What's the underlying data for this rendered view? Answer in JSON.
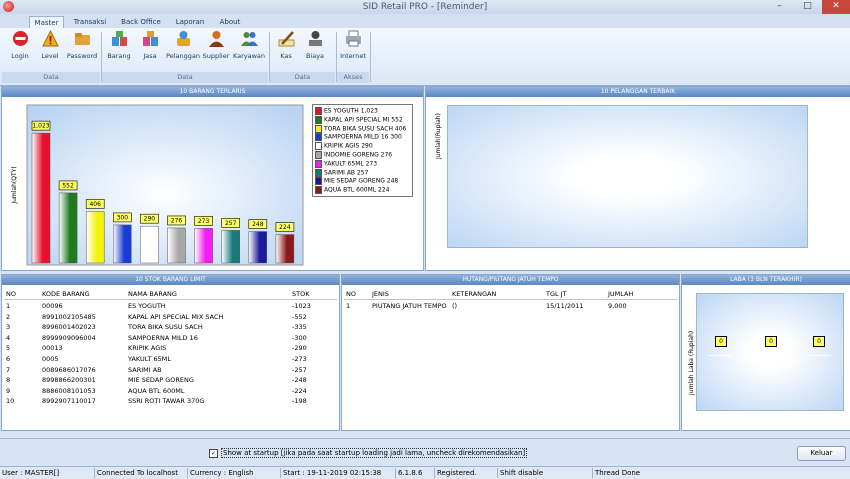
{
  "window": {
    "title": "SID Retail PRO - [Reminder]",
    "min": "–",
    "max": "□",
    "close": "✕"
  },
  "tabs": [
    "Master",
    "Transaksi",
    "Back Office",
    "Laporan",
    "About"
  ],
  "ribbon": {
    "buttons": [
      {
        "label": "Login",
        "color": "#d9252a",
        "icon": "no-entry-icon"
      },
      {
        "label": "Level",
        "color": "#e8b420",
        "icon": "warning-icon"
      },
      {
        "label": "Password",
        "color": "#e2a13a",
        "icon": "folder-icon"
      },
      {
        "label": "Barang",
        "color": "#3f8fd4",
        "icon": "boxes-icon"
      },
      {
        "label": "Jasa",
        "color": "#d04a8a",
        "icon": "boxes-icon"
      },
      {
        "label": "Pelanggan",
        "color": "#e5a32b",
        "icon": "customer-icon"
      },
      {
        "label": "Supplier",
        "color": "#d96a21",
        "icon": "person-icon"
      },
      {
        "label": "Karyawan",
        "color": "#4f8a3b",
        "icon": "people-icon"
      },
      {
        "label": "Kas",
        "color": "#b08438",
        "icon": "pen-icon"
      },
      {
        "label": "Biaya",
        "color": "#444444",
        "icon": "cost-icon"
      },
      {
        "label": "Internet",
        "color": "#6b7c8f",
        "icon": "printer-icon"
      }
    ],
    "groups": [
      "Data",
      "Data",
      "Data",
      "Akses"
    ]
  },
  "panels": {
    "top_items": "10 BARANG TERLARIS",
    "top_customers": "10 PELANGGAN TERBAIK",
    "stock": "10 STOK BARANG LIMIT",
    "debts": "HUTANG/PIUTANG JATUH TEMPO",
    "profit": "LABA (3 BLN TERAKHIR)"
  },
  "chart_data": [
    {
      "type": "bar",
      "title": "10 BARANG TERLARIS",
      "ylabel": "Jumlah(QTY)",
      "categories": [
        "ES YOGUTH",
        "KAPAL API SPECIAL MI",
        "TORA BIKA SUSU SACH",
        "SAMPOERNA MILD 16",
        "KRIPIK AGIS",
        "INDOMIE GORENG",
        "YAKULT 65ML",
        "SARIMI AB",
        "MIE SEDAP GORENG",
        "AQUA BTL 600ML"
      ],
      "values": [
        1023,
        552,
        406,
        300,
        290,
        276,
        273,
        257,
        248,
        224
      ],
      "value_labels": [
        "1,023",
        "552",
        "406",
        "300",
        "290",
        "276",
        "273",
        "257",
        "248",
        "224"
      ],
      "legend": [
        "ES YOGUTH 1,023",
        "KAPAL API SPECIAL MI 552",
        "TORA BIKA SUSU SACH 406",
        "SAMPOERNA MILD 16 300",
        "KRIPIK AGIS 290",
        "INDOMIE GORENG 276",
        "YAKULT 65ML 273",
        "SARIMI AB 257",
        "MIE SEDAP GORENG 248",
        "AQUA BTL 600ML 224"
      ],
      "colors": [
        "#e8102a",
        "#1f7a1f",
        "#f2f20a",
        "#1a3cd6",
        "#ffffff",
        "#a8a8a8",
        "#f21ef2",
        "#1a7a7a",
        "#1a1a9a",
        "#8a1a1a"
      ],
      "legend_position": "right"
    },
    {
      "type": "bar",
      "title": "10 PELANGGAN TERBAIK",
      "ylabel": "Jumlah(Rupiah)",
      "categories": [],
      "values": []
    },
    {
      "type": "bar",
      "title": "LABA (3 BLN TERAKHIR)",
      "ylabel": "Jumlah Laba (Rupiah)",
      "categories": [
        "",
        "",
        ""
      ],
      "values": [
        0,
        0,
        0
      ],
      "value_labels": [
        "0",
        "0",
        "0"
      ]
    }
  ],
  "stock_table": {
    "headers": [
      "NO",
      "KODE BARANG",
      "NAMA BARANG",
      "STOK"
    ],
    "rows": [
      [
        "1",
        "00096",
        "ES YOGUTH",
        "-1023"
      ],
      [
        "2",
        "8991002105485",
        "KAPAL API SPECIAL MIX SACH",
        "-552"
      ],
      [
        "3",
        "8996001402023",
        "TORA BIKA SUSU SACH",
        "-335"
      ],
      [
        "4",
        "8999909096004",
        "SAMPOERNA MILD 16",
        "-300"
      ],
      [
        "5",
        "00013",
        "KRIPIK AGIS",
        "-290"
      ],
      [
        "6",
        "0005",
        "YAKULT 65ML",
        "-273"
      ],
      [
        "7",
        "0089686017076",
        "SARIMI AB",
        "-257"
      ],
      [
        "8",
        "8998866200301",
        "MIE SEDAP GORENG",
        "-248"
      ],
      [
        "9",
        "8886008101053",
        "AQUA BTL 600ML",
        "-224"
      ],
      [
        "10",
        "8992907110017",
        "SSRI ROTI TAWAR 370G",
        "-198"
      ]
    ]
  },
  "debt_table": {
    "headers": [
      "NO",
      "JENIS",
      "KETERANGAN",
      "TGL JT",
      "JUMLAH"
    ],
    "rows": [
      [
        "1",
        "PIUTANG JATUH TEMPO",
        "()",
        "15/11/2011",
        "9,000"
      ]
    ]
  },
  "startup": {
    "checked": "✓",
    "label": "Show at startup [jika pada saat startup loading jadi lama, uncheck direkomendasikan]"
  },
  "keluar": "Keluar",
  "status": [
    "User : MASTER[]",
    "Connected To localhost",
    "Currency : English",
    "Start  :  19-11-2019 02:15:38",
    "6.1.8.6",
    "Registered.",
    "Shift disable",
    "Thread Done"
  ]
}
